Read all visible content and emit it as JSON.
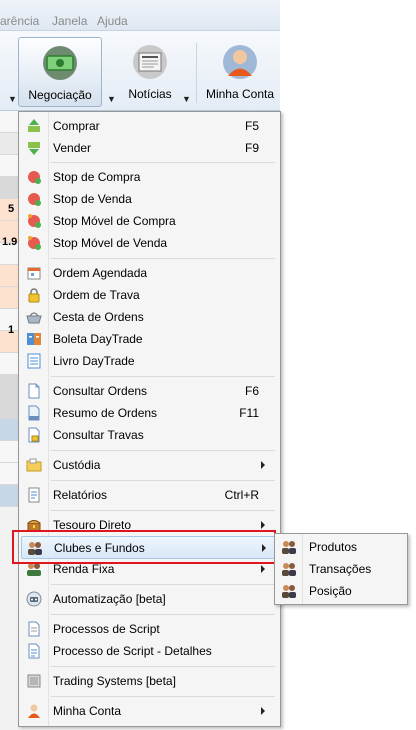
{
  "menubar": {
    "items": [
      "arência",
      "Janela",
      "Ajuda"
    ]
  },
  "ribbon": {
    "buttons": [
      {
        "label": "Negociação",
        "icon": "money-icon"
      },
      {
        "label": "Notícias",
        "icon": "newspaper-icon"
      },
      {
        "label": "Minha Conta",
        "icon": "user-icon"
      }
    ]
  },
  "background": {
    "row_values": [
      "5",
      "1.9",
      "1"
    ]
  },
  "menu": {
    "items": [
      {
        "label": "Comprar",
        "shortcut": "F5",
        "icon": "buy-icon"
      },
      {
        "label": "Vender",
        "shortcut": "F9",
        "icon": "sell-icon"
      },
      {
        "label": "Stop de Compra",
        "icon": "stop-buy-icon"
      },
      {
        "label": "Stop de Venda",
        "icon": "stop-sell-icon"
      },
      {
        "label": "Stop Móvel de Compra",
        "icon": "trailing-stop-buy-icon"
      },
      {
        "label": "Stop Móvel de Venda",
        "icon": "trailing-stop-sell-icon"
      },
      {
        "label": "Ordem Agendada",
        "icon": "calendar-icon"
      },
      {
        "label": "Ordem de Trava",
        "icon": "lock-icon"
      },
      {
        "label": "Cesta de Ordens",
        "icon": "basket-icon"
      },
      {
        "label": "Boleta DayTrade",
        "icon": "daytrade-ticket-icon"
      },
      {
        "label": "Livro DayTrade",
        "icon": "daytrade-book-icon"
      },
      {
        "label": "Consultar Ordens",
        "shortcut": "F6",
        "icon": "document-icon"
      },
      {
        "label": "Resumo de Ordens",
        "shortcut": "F11",
        "icon": "summary-document-icon"
      },
      {
        "label": "Consultar Travas",
        "icon": "lock-document-icon"
      },
      {
        "label": "Custódia",
        "icon": "folder-icon",
        "submenu": true
      },
      {
        "label": "Relatórios",
        "shortcut": "Ctrl+R",
        "icon": "report-icon"
      },
      {
        "label": "Tesouro Direto",
        "icon": "treasure-icon",
        "submenu": true
      },
      {
        "label": "Clubes e Fundos",
        "icon": "group-icon",
        "submenu": true,
        "highlighted": true
      },
      {
        "label": "Renda Fixa",
        "icon": "fixed-income-icon",
        "submenu": true
      },
      {
        "label": "Automatização [beta]",
        "icon": "robot-icon"
      },
      {
        "label": "Processos de Script",
        "icon": "script-icon"
      },
      {
        "label": "Processo de Script - Detalhes",
        "icon": "script-details-icon"
      },
      {
        "label": "Trading Systems [beta]",
        "icon": "trading-systems-icon"
      },
      {
        "label": "Minha Conta",
        "icon": "user-icon",
        "submenu": true
      }
    ]
  },
  "submenu": {
    "items": [
      {
        "label": "Produtos",
        "icon": "group-icon"
      },
      {
        "label": "Transações",
        "icon": "group-icon"
      },
      {
        "label": "Posição",
        "icon": "group-icon"
      }
    ]
  },
  "colors": {
    "highlight_border": "#e0151e",
    "menu_bg": "#f5f5f5",
    "hover_bg": "#d9e8f7"
  }
}
